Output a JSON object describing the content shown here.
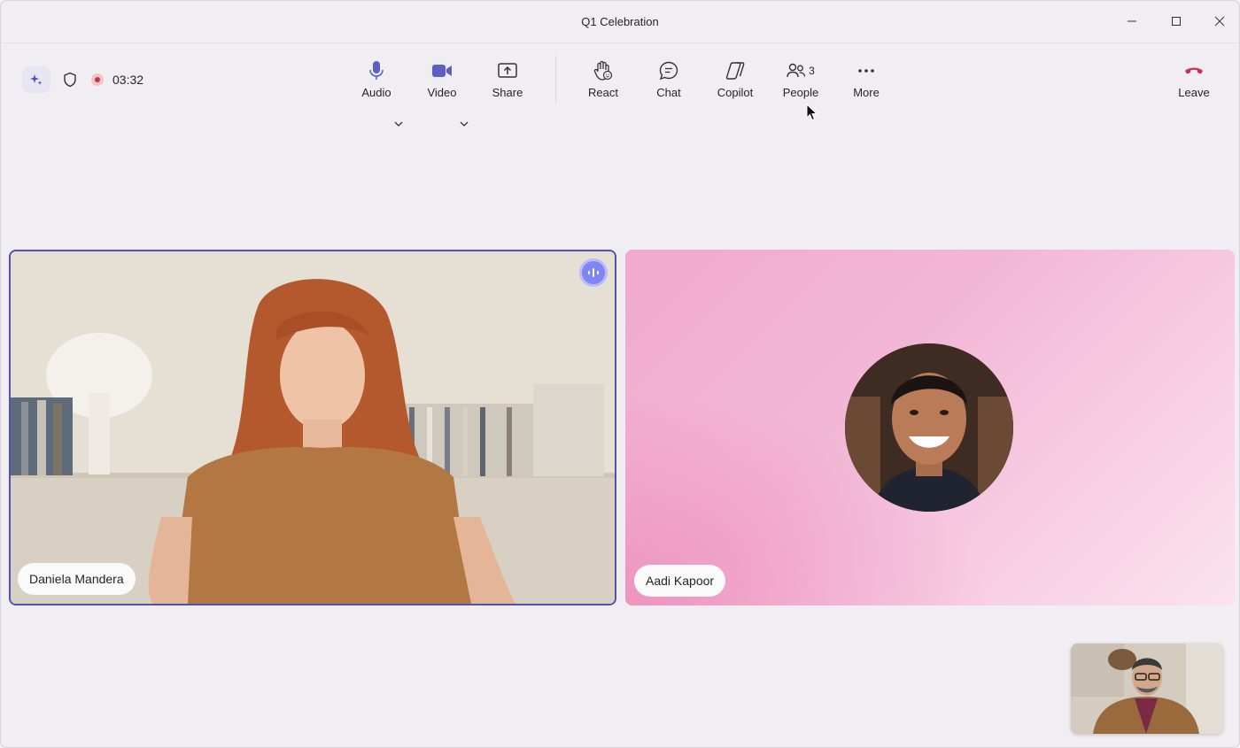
{
  "window": {
    "title": "Q1 Celebration"
  },
  "status": {
    "timer": "03:32"
  },
  "toolbar": {
    "audio_label": "Audio",
    "video_label": "Video",
    "share_label": "Share",
    "react_label": "React",
    "chat_label": "Chat",
    "copilot_label": "Copilot",
    "people_label": "People",
    "people_count": "3",
    "more_label": "More",
    "leave_label": "Leave"
  },
  "participants": [
    {
      "name": "Daniela Mandera",
      "speaking": true
    },
    {
      "name": "Aadi Kapoor",
      "speaking": false
    }
  ],
  "colors": {
    "accent": "#4f52b2",
    "leave": "#c4314b",
    "background": "#f0eef2"
  }
}
